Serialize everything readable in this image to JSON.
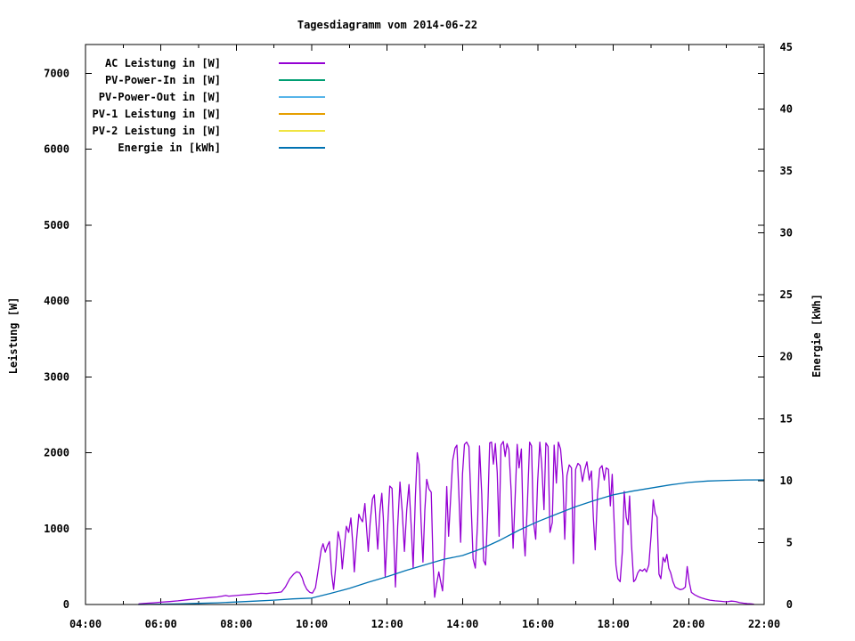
{
  "chart_data": {
    "type": "line",
    "title": "Tagesdiagramm vom 2014-06-22",
    "background_color": "#ffffff",
    "grid": false,
    "legend_position": "top-left-inside",
    "x_axis": {
      "unit": "time_of_day",
      "range": [
        4,
        22
      ],
      "major_ticks": [
        {
          "h": 4,
          "label": "04:00"
        },
        {
          "h": 6,
          "label": "06:00"
        },
        {
          "h": 8,
          "label": "08:00"
        },
        {
          "h": 10,
          "label": "10:00"
        },
        {
          "h": 12,
          "label": "12:00"
        },
        {
          "h": 14,
          "label": "14:00"
        },
        {
          "h": 16,
          "label": "16:00"
        },
        {
          "h": 18,
          "label": "18:00"
        },
        {
          "h": 20,
          "label": "20:00"
        },
        {
          "h": 22,
          "label": "22:00"
        }
      ],
      "minor_tick_hours": [
        5,
        7,
        9,
        11,
        13,
        15,
        17,
        19,
        21
      ]
    },
    "y_axis_left": {
      "label": "Leistung [W]",
      "range": [
        0,
        7380
      ],
      "ticks": [
        {
          "v": 0,
          "label": "0"
        },
        {
          "v": 1000,
          "label": "1000"
        },
        {
          "v": 2000,
          "label": "2000"
        },
        {
          "v": 3000,
          "label": "3000"
        },
        {
          "v": 4000,
          "label": "4000"
        },
        {
          "v": 5000,
          "label": "5000"
        },
        {
          "v": 6000,
          "label": "6000"
        },
        {
          "v": 7000,
          "label": "7000"
        }
      ]
    },
    "y_axis_right": {
      "label": "Energie [kWh]",
      "range": [
        0,
        45.2
      ],
      "ticks": [
        {
          "v": 0,
          "label": "0"
        },
        {
          "v": 5,
          "label": "5"
        },
        {
          "v": 10,
          "label": "10"
        },
        {
          "v": 15,
          "label": "15"
        },
        {
          "v": 20,
          "label": "20"
        },
        {
          "v": 25,
          "label": "25"
        },
        {
          "v": 30,
          "label": "30"
        },
        {
          "v": 35,
          "label": "35"
        },
        {
          "v": 40,
          "label": "40"
        },
        {
          "v": 45,
          "label": "45"
        }
      ]
    },
    "series": [
      {
        "name": "AC Leistung in [W]",
        "color": "#9400d3",
        "axis": "y1",
        "points": [
          [
            5.42,
            8
          ],
          [
            5.5,
            12
          ],
          [
            5.65,
            18
          ],
          [
            5.8,
            22
          ],
          [
            6.0,
            30
          ],
          [
            6.2,
            38
          ],
          [
            6.45,
            48
          ],
          [
            6.7,
            62
          ],
          [
            6.9,
            72
          ],
          [
            7.1,
            82
          ],
          [
            7.3,
            92
          ],
          [
            7.5,
            100
          ],
          [
            7.64,
            112
          ],
          [
            7.72,
            118
          ],
          [
            7.8,
            110
          ],
          [
            8.0,
            118
          ],
          [
            8.2,
            128
          ],
          [
            8.35,
            132
          ],
          [
            8.5,
            140
          ],
          [
            8.65,
            148
          ],
          [
            8.8,
            144
          ],
          [
            8.95,
            152
          ],
          [
            9.1,
            158
          ],
          [
            9.2,
            166
          ],
          [
            9.3,
            230
          ],
          [
            9.42,
            340
          ],
          [
            9.52,
            400
          ],
          [
            9.6,
            432
          ],
          [
            9.68,
            418
          ],
          [
            9.75,
            350
          ],
          [
            9.8,
            270
          ],
          [
            9.87,
            200
          ],
          [
            9.95,
            160
          ],
          [
            10.02,
            150
          ],
          [
            10.1,
            220
          ],
          [
            10.18,
            480
          ],
          [
            10.25,
            720
          ],
          [
            10.3,
            800
          ],
          [
            10.36,
            690
          ],
          [
            10.42,
            780
          ],
          [
            10.47,
            830
          ],
          [
            10.53,
            400
          ],
          [
            10.58,
            200
          ],
          [
            10.64,
            520
          ],
          [
            10.7,
            960
          ],
          [
            10.76,
            830
          ],
          [
            10.81,
            470
          ],
          [
            10.87,
            780
          ],
          [
            10.92,
            1030
          ],
          [
            10.98,
            950
          ],
          [
            11.04,
            1140
          ],
          [
            11.09,
            800
          ],
          [
            11.13,
            430
          ],
          [
            11.19,
            860
          ],
          [
            11.25,
            1190
          ],
          [
            11.3,
            1130
          ],
          [
            11.35,
            1090
          ],
          [
            11.41,
            1330
          ],
          [
            11.46,
            970
          ],
          [
            11.5,
            700
          ],
          [
            11.55,
            1080
          ],
          [
            11.61,
            1390
          ],
          [
            11.66,
            1445
          ],
          [
            11.71,
            1050
          ],
          [
            11.75,
            730
          ],
          [
            11.81,
            1230
          ],
          [
            11.86,
            1465
          ],
          [
            11.9,
            1140
          ],
          [
            11.95,
            370
          ],
          [
            12.01,
            990
          ],
          [
            12.07,
            1560
          ],
          [
            12.13,
            1530
          ],
          [
            12.18,
            840
          ],
          [
            12.22,
            230
          ],
          [
            12.28,
            1030
          ],
          [
            12.34,
            1615
          ],
          [
            12.4,
            1230
          ],
          [
            12.46,
            700
          ],
          [
            12.52,
            1250
          ],
          [
            12.58,
            1580
          ],
          [
            12.64,
            1010
          ],
          [
            12.69,
            480
          ],
          [
            12.75,
            1420
          ],
          [
            12.8,
            2000
          ],
          [
            12.85,
            1850
          ],
          [
            12.9,
            1090
          ],
          [
            12.95,
            560
          ],
          [
            13.0,
            1240
          ],
          [
            13.05,
            1650
          ],
          [
            13.11,
            1520
          ],
          [
            13.17,
            1480
          ],
          [
            13.22,
            520
          ],
          [
            13.26,
            95
          ],
          [
            13.31,
            260
          ],
          [
            13.37,
            430
          ],
          [
            13.42,
            300
          ],
          [
            13.47,
            180
          ],
          [
            13.53,
            700
          ],
          [
            13.58,
            1555
          ],
          [
            13.63,
            900
          ],
          [
            13.69,
            1450
          ],
          [
            13.74,
            1900
          ],
          [
            13.8,
            2060
          ],
          [
            13.85,
            2100
          ],
          [
            13.9,
            1500
          ],
          [
            13.95,
            820
          ],
          [
            14.0,
            1720
          ],
          [
            14.05,
            2110
          ],
          [
            14.11,
            2140
          ],
          [
            14.17,
            2080
          ],
          [
            14.22,
            1440
          ],
          [
            14.28,
            600
          ],
          [
            14.34,
            480
          ],
          [
            14.4,
            1100
          ],
          [
            14.45,
            2090
          ],
          [
            14.51,
            1450
          ],
          [
            14.56,
            580
          ],
          [
            14.61,
            520
          ],
          [
            14.67,
            1260
          ],
          [
            14.72,
            2130
          ],
          [
            14.77,
            2140
          ],
          [
            14.82,
            1850
          ],
          [
            14.87,
            2120
          ],
          [
            14.92,
            1740
          ],
          [
            14.97,
            900
          ],
          [
            15.02,
            2100
          ],
          [
            15.08,
            2150
          ],
          [
            15.13,
            1950
          ],
          [
            15.18,
            2120
          ],
          [
            15.23,
            2040
          ],
          [
            15.29,
            1500
          ],
          [
            15.34,
            740
          ],
          [
            15.39,
            1350
          ],
          [
            15.45,
            2110
          ],
          [
            15.5,
            1800
          ],
          [
            15.56,
            2050
          ],
          [
            15.61,
            1000
          ],
          [
            15.66,
            640
          ],
          [
            15.72,
            1310
          ],
          [
            15.78,
            2140
          ],
          [
            15.83,
            2090
          ],
          [
            15.88,
            1100
          ],
          [
            15.94,
            860
          ],
          [
            15.99,
            1600
          ],
          [
            16.05,
            2140
          ],
          [
            16.1,
            1850
          ],
          [
            16.16,
            1250
          ],
          [
            16.21,
            2130
          ],
          [
            16.27,
            2080
          ],
          [
            16.32,
            950
          ],
          [
            16.38,
            1080
          ],
          [
            16.43,
            2100
          ],
          [
            16.49,
            1600
          ],
          [
            16.54,
            2140
          ],
          [
            16.6,
            2050
          ],
          [
            16.66,
            1700
          ],
          [
            16.71,
            860
          ],
          [
            16.77,
            1700
          ],
          [
            16.83,
            1840
          ],
          [
            16.89,
            1800
          ],
          [
            16.94,
            540
          ],
          [
            17.0,
            1780
          ],
          [
            17.06,
            1860
          ],
          [
            17.12,
            1830
          ],
          [
            17.18,
            1620
          ],
          [
            17.24,
            1780
          ],
          [
            17.3,
            1880
          ],
          [
            17.36,
            1640
          ],
          [
            17.42,
            1760
          ],
          [
            17.47,
            1150
          ],
          [
            17.52,
            720
          ],
          [
            17.58,
            1450
          ],
          [
            17.64,
            1790
          ],
          [
            17.7,
            1830
          ],
          [
            17.76,
            1640
          ],
          [
            17.81,
            1800
          ],
          [
            17.87,
            1780
          ],
          [
            17.92,
            1300
          ],
          [
            17.97,
            1715
          ],
          [
            18.02,
            1100
          ],
          [
            18.07,
            520
          ],
          [
            18.12,
            340
          ],
          [
            18.18,
            300
          ],
          [
            18.24,
            700
          ],
          [
            18.29,
            1490
          ],
          [
            18.34,
            1150
          ],
          [
            18.39,
            1050
          ],
          [
            18.43,
            1430
          ],
          [
            18.48,
            800
          ],
          [
            18.54,
            300
          ],
          [
            18.59,
            330
          ],
          [
            18.65,
            420
          ],
          [
            18.71,
            460
          ],
          [
            18.77,
            440
          ],
          [
            18.83,
            470
          ],
          [
            18.88,
            430
          ],
          [
            18.94,
            520
          ],
          [
            19.0,
            900
          ],
          [
            19.06,
            1380
          ],
          [
            19.11,
            1200
          ],
          [
            19.16,
            1150
          ],
          [
            19.21,
            400
          ],
          [
            19.26,
            340
          ],
          [
            19.32,
            620
          ],
          [
            19.37,
            560
          ],
          [
            19.42,
            660
          ],
          [
            19.47,
            480
          ],
          [
            19.52,
            420
          ],
          [
            19.58,
            300
          ],
          [
            19.64,
            230
          ],
          [
            19.71,
            210
          ],
          [
            19.78,
            195
          ],
          [
            19.85,
            205
          ],
          [
            19.91,
            230
          ],
          [
            19.96,
            500
          ],
          [
            20.01,
            300
          ],
          [
            20.07,
            160
          ],
          [
            20.15,
            130
          ],
          [
            20.25,
            105
          ],
          [
            20.35,
            85
          ],
          [
            20.45,
            70
          ],
          [
            20.56,
            58
          ],
          [
            20.7,
            48
          ],
          [
            20.85,
            42
          ],
          [
            21.0,
            35
          ],
          [
            21.13,
            45
          ],
          [
            21.24,
            40
          ],
          [
            21.35,
            25
          ],
          [
            21.45,
            18
          ],
          [
            21.55,
            12
          ],
          [
            21.65,
            8
          ],
          [
            21.72,
            5
          ]
        ]
      },
      {
        "name": "PV-Power-In in [W]",
        "color": "#009e73",
        "axis": "y1",
        "points": []
      },
      {
        "name": "PV-Power-Out in [W]",
        "color": "#56b4e9",
        "axis": "y1",
        "points": []
      },
      {
        "name": "PV-1 Leistung in [W]",
        "color": "#e69f00",
        "axis": "y1",
        "points": []
      },
      {
        "name": "PV-2 Leistung in [W]",
        "color": "#f0e442",
        "axis": "y1",
        "points": []
      },
      {
        "name": "Energie in [kWh]",
        "color": "#0072b2",
        "axis": "y2",
        "points": [
          [
            5.4,
            0
          ],
          [
            6.0,
            0.02
          ],
          [
            6.5,
            0.05
          ],
          [
            7.0,
            0.09
          ],
          [
            7.5,
            0.14
          ],
          [
            8.0,
            0.2
          ],
          [
            8.5,
            0.27
          ],
          [
            9.0,
            0.35
          ],
          [
            9.5,
            0.45
          ],
          [
            10.0,
            0.52
          ],
          [
            10.5,
            0.9
          ],
          [
            11.0,
            1.3
          ],
          [
            11.5,
            1.8
          ],
          [
            12.0,
            2.25
          ],
          [
            12.5,
            2.75
          ],
          [
            13.0,
            3.2
          ],
          [
            13.5,
            3.65
          ],
          [
            14.0,
            3.95
          ],
          [
            14.5,
            4.5
          ],
          [
            15.0,
            5.2
          ],
          [
            15.5,
            6.0
          ],
          [
            16.0,
            6.7
          ],
          [
            16.5,
            7.3
          ],
          [
            17.0,
            7.9
          ],
          [
            17.5,
            8.4
          ],
          [
            18.0,
            8.85
          ],
          [
            18.5,
            9.15
          ],
          [
            19.0,
            9.4
          ],
          [
            19.5,
            9.65
          ],
          [
            20.0,
            9.85
          ],
          [
            20.5,
            9.97
          ],
          [
            21.0,
            10.02
          ],
          [
            21.5,
            10.05
          ],
          [
            22.0,
            10.06
          ]
        ]
      }
    ]
  }
}
